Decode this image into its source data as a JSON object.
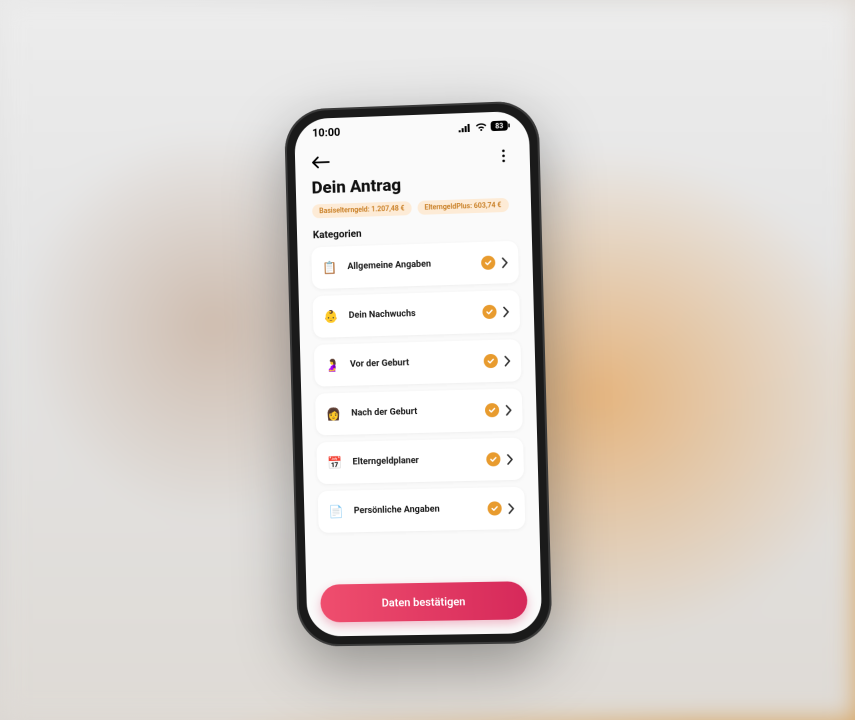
{
  "status": {
    "time": "10:00",
    "battery": "83"
  },
  "page": {
    "title": "Dein Antrag"
  },
  "pills": [
    {
      "label": "Basiselterngeld: 1.207,48 €"
    },
    {
      "label": "ElterngeldPlus: 603,74 €"
    }
  ],
  "section": {
    "label": "Kategorien"
  },
  "categories": [
    {
      "icon": "📋",
      "label": "Allgemeine Angaben",
      "complete": true
    },
    {
      "icon": "👶",
      "label": "Dein Nachwuchs",
      "complete": true
    },
    {
      "icon": "🤰",
      "label": "Vor der Geburt",
      "complete": true
    },
    {
      "icon": "👩",
      "label": "Nach der Geburt",
      "complete": true
    },
    {
      "icon": "📅",
      "label": "Elterngeldplaner",
      "complete": true
    },
    {
      "icon": "📄",
      "label": "Persönliche Angaben",
      "complete": true
    }
  ],
  "confirm": {
    "label": "Daten bestätigen"
  }
}
